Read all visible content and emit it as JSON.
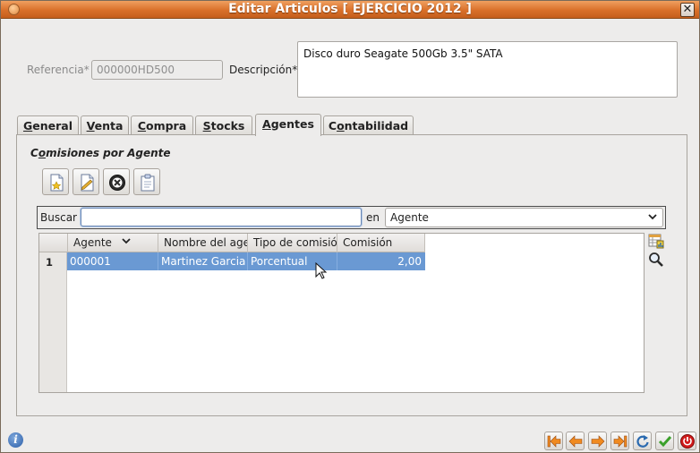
{
  "window": {
    "title": "Editar Articulos [ EJERCICIO 2012 ]",
    "close_glyph": "✕"
  },
  "form": {
    "referencia_label": "Referencia*",
    "referencia_value": "000000HD500",
    "descripcion_label": "Descripción*",
    "descripcion_value": "Disco duro Seagate 500Gb 3.5\" SATA"
  },
  "tabs": [
    {
      "label": "General",
      "mnemonic": "G",
      "rest": "eneral"
    },
    {
      "label": "Venta",
      "mnemonic": "V",
      "rest": "enta"
    },
    {
      "label": "Compra",
      "mnemonic": "C",
      "rest": "ompra"
    },
    {
      "label": "Stocks",
      "mnemonic": "S",
      "rest": "tocks"
    },
    {
      "label": "Agentes",
      "mnemonic": "A",
      "rest": "gentes",
      "active": true
    },
    {
      "label": "Contabilidad",
      "pre": "C",
      "mnemonic": "o",
      "rest": "ntabilidad"
    }
  ],
  "section": {
    "title_pre": "C",
    "title_mnemonic": "o",
    "title_rest": "misiones por Agente",
    "title": "Comisiones por Agente"
  },
  "toolbar_icons": [
    "new-record-icon",
    "edit-record-icon",
    "delete-record-icon",
    "copy-record-icon"
  ],
  "search": {
    "label": "Buscar",
    "value": "",
    "in_label": "en",
    "field_selected": "Agente"
  },
  "table": {
    "columns": [
      "Agente",
      "Nombre del agente",
      "Tipo de comisión",
      "Comisión"
    ],
    "rows": [
      {
        "num": "1",
        "agente": "000001",
        "nombre": "Martinez Garcia",
        "tipo": "Porcentual",
        "comision": "2,00",
        "selected": true
      }
    ]
  },
  "side_icons": [
    "table-config-icon",
    "search-magnifier-icon"
  ],
  "bottom": {
    "info_glyph": "i",
    "nav_icons": [
      "first-icon",
      "previous-icon",
      "next-icon",
      "last-icon",
      "refresh-icon",
      "accept-icon",
      "cancel-icon"
    ]
  },
  "colors": {
    "titlebar": "#d9702a",
    "selection": "#6a99d3",
    "accent_green": "#3aa02a",
    "cancel_red": "#d11a1a",
    "nav_orange": "#f08a20"
  }
}
